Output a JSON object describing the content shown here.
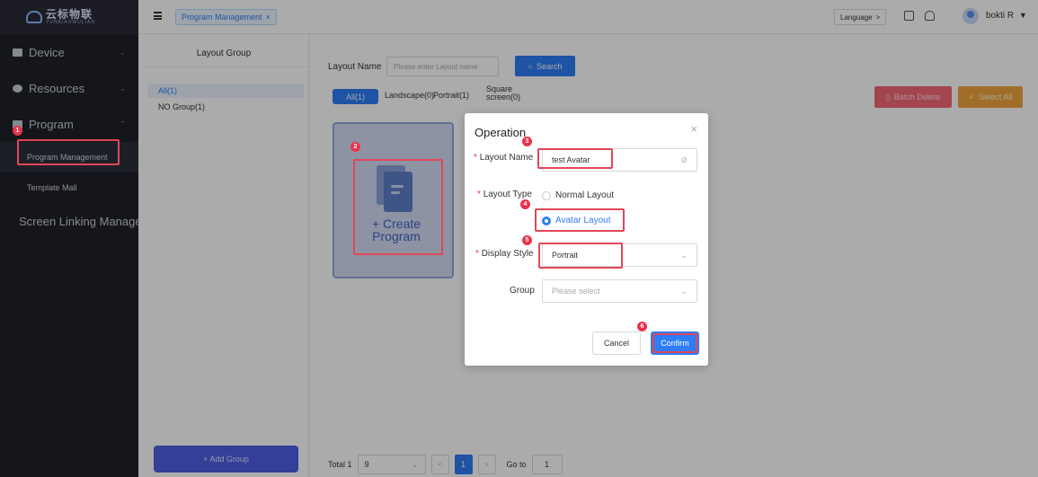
{
  "logo": {
    "text_cn": "云标物联",
    "text_en": "YUNBIAOWULIAN"
  },
  "sidebar": {
    "items": [
      {
        "label": "Device",
        "icon": "server-icon"
      },
      {
        "label": "Resources",
        "icon": "layers-icon"
      },
      {
        "label": "Program",
        "icon": "program-icon"
      },
      {
        "label": "Screen Linking Manage",
        "icon": "grid-icon"
      }
    ],
    "subitems": [
      {
        "label": "Program Management"
      },
      {
        "label": "Template Mall"
      }
    ]
  },
  "topbar": {
    "tab_label": "Program Management",
    "tab_close": "×",
    "language_label": "Language",
    "language_chevron": ">",
    "user_name": "bokti R",
    "user_chevron": "▼"
  },
  "group_panel": {
    "title": "Layout Group",
    "items": [
      "All(1)",
      "NO Group(1)"
    ],
    "add_button": "+ Add Group"
  },
  "main": {
    "layout_name_label": "Layout Name",
    "layout_name_placeholder": "Please enter Layout name",
    "search_button": "Search",
    "filters": [
      "All(1)",
      "Landscape(0)",
      "Portrait(1)",
      "Square",
      "screen(0)"
    ],
    "batch_delete": "Batch Delete",
    "select_all": "Select All",
    "create_program_line1": "+ Create",
    "create_program_line2": "Program",
    "pagination": {
      "total": "Total 1",
      "page_size": "9",
      "prev": "<",
      "current_page": "1",
      "next": ">",
      "goto_label": "Go to",
      "goto_value": "1"
    }
  },
  "dialog": {
    "title": "Operation",
    "close": "×",
    "layout_name_label": "Layout Name",
    "layout_name_value": "test Avatar",
    "layout_type_label": "Layout Type",
    "layout_type_options": [
      "Normal Layout",
      "Avatar Layout"
    ],
    "layout_type_selected": "Avatar Layout",
    "display_style_label": "Display Style",
    "display_style_value": "Portrait",
    "group_label": "Group",
    "group_placeholder": "Please select",
    "cancel_button": "Cancel",
    "confirm_button": "Confirm",
    "required_mark": "*",
    "chevron": "⌄"
  },
  "annotations": [
    "1",
    "2",
    "3",
    "4",
    "5",
    "6"
  ],
  "colors": {
    "accent": "#2e7cf6",
    "sidebar_bg": "#1f2129",
    "highlight": "#e04757",
    "danger": "#f26877",
    "warning": "#efa53e"
  }
}
